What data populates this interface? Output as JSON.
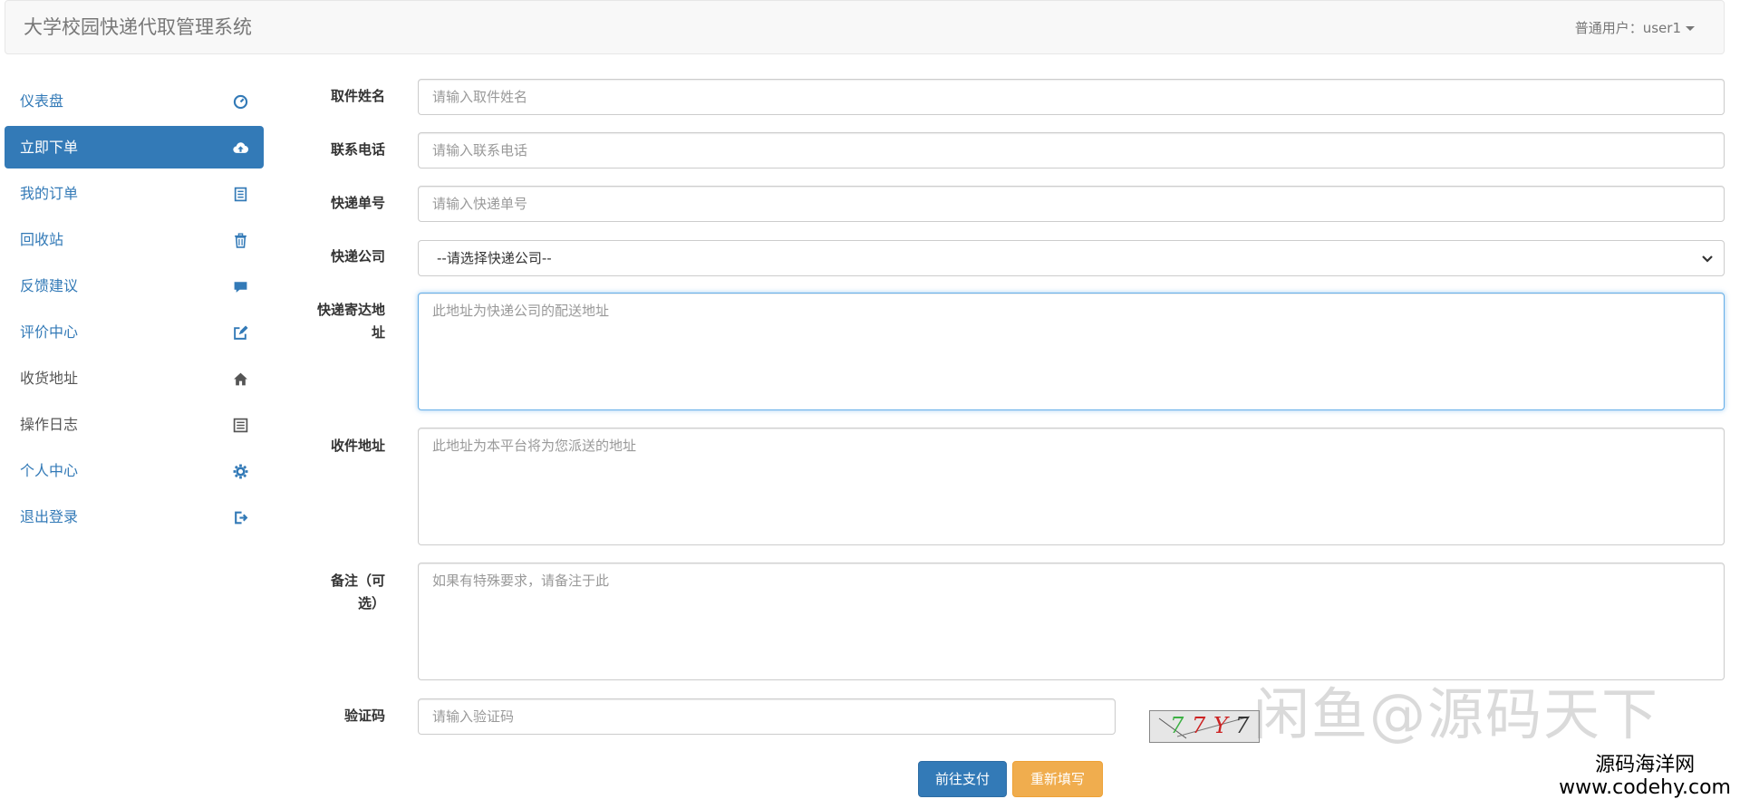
{
  "navbar": {
    "brand": "大学校园快递代取管理系统",
    "user_label": "普通用户：user1"
  },
  "sidebar": {
    "items": [
      {
        "label": "仪表盘",
        "icon": "dashboard-icon"
      },
      {
        "label": "立即下单",
        "icon": "cloud-upload-icon"
      },
      {
        "label": "我的订单",
        "icon": "list-icon"
      },
      {
        "label": "回收站",
        "icon": "trash-icon"
      },
      {
        "label": "反馈建议",
        "icon": "comment-icon"
      },
      {
        "label": "评价中心",
        "icon": "edit-icon"
      },
      {
        "label": "收货地址",
        "icon": "home-icon"
      },
      {
        "label": "操作日志",
        "icon": "list-alt-icon"
      },
      {
        "label": "个人中心",
        "icon": "gear-icon"
      },
      {
        "label": "退出登录",
        "icon": "logout-icon"
      }
    ],
    "active_index": 1
  },
  "form": {
    "name": {
      "label": "取件姓名",
      "placeholder": "请输入取件姓名",
      "value": ""
    },
    "phone": {
      "label": "联系电话",
      "placeholder": "请输入联系电话",
      "value": ""
    },
    "tracking": {
      "label": "快递单号",
      "placeholder": "请输入快递单号",
      "value": ""
    },
    "company": {
      "label": "快递公司",
      "selected": "--请选择快递公司--"
    },
    "sender_address": {
      "label_line1": "快递寄达地",
      "label_line2": "址",
      "placeholder": "此地址为快递公司的配送地址"
    },
    "receiver_address": {
      "label": "收件地址",
      "placeholder": "此地址为本平台将为您派送的地址"
    },
    "notes": {
      "label_line1": "备注（可",
      "label_line2": "选）",
      "placeholder": "如果有特殊要求，请备注于此"
    },
    "captcha": {
      "label": "验证码",
      "placeholder": "请输入验证码",
      "image_chars": [
        "7",
        "7",
        "Y",
        "7"
      ],
      "image_colors": [
        "#3cb043",
        "#cc2222",
        "#cc2222",
        "#333333"
      ]
    },
    "submit_label": "前往支付",
    "reset_label": "重新填写"
  },
  "watermarks": {
    "overlay": "闲鱼@源码天下",
    "site_name": "源码海洋网",
    "site_url": "www.codehy.com"
  },
  "colors": {
    "primary": "#337ab7",
    "warning": "#f0ad4e",
    "navbar_bg": "#f8f8f8"
  }
}
